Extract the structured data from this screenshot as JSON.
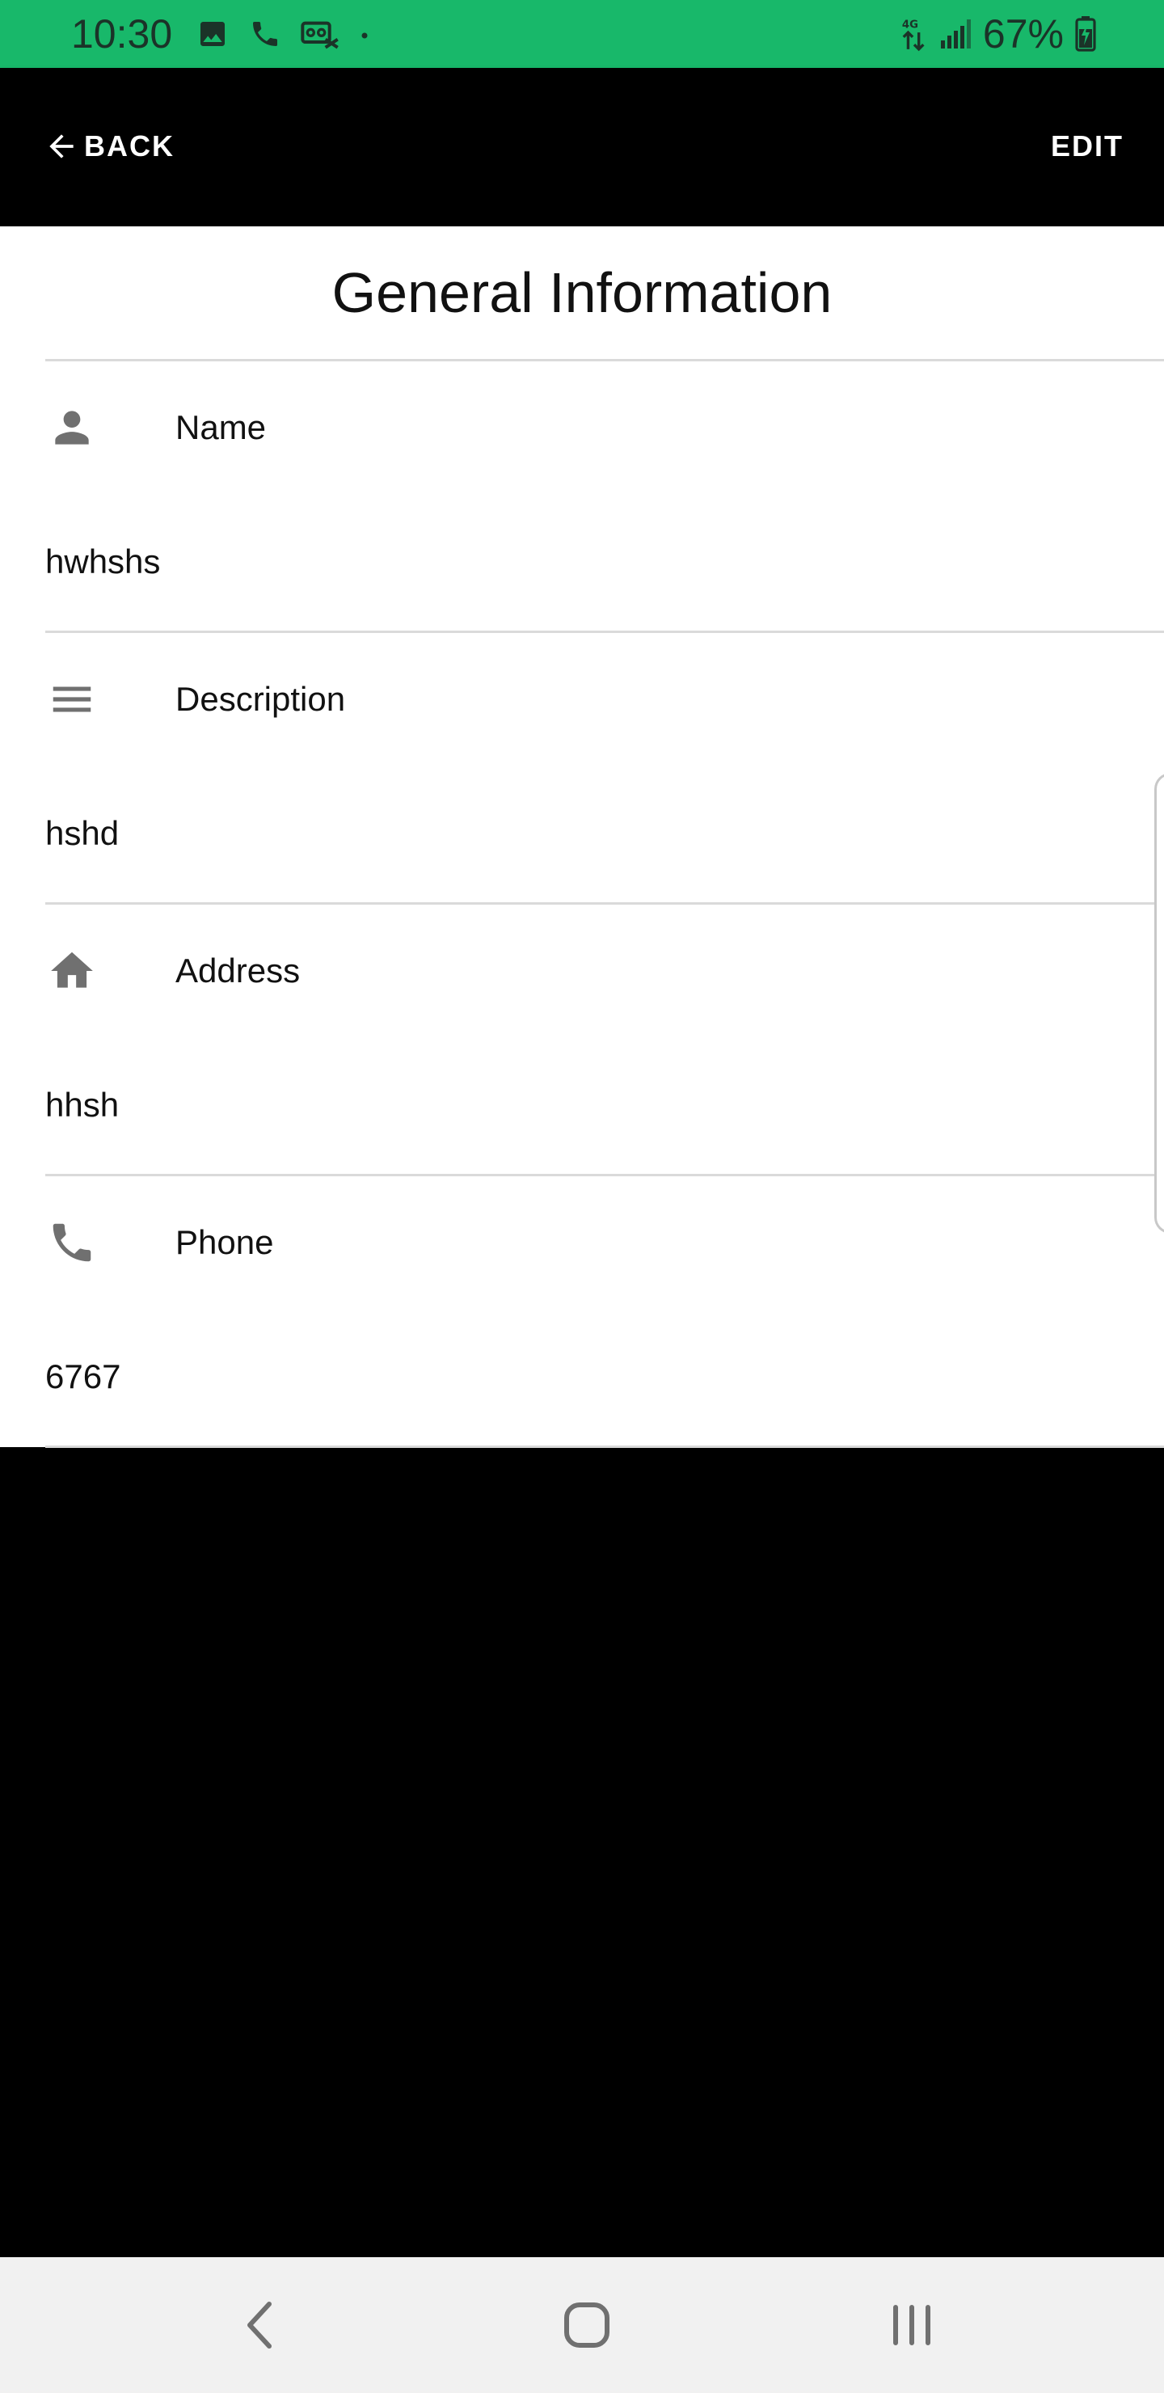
{
  "status_bar": {
    "time": "10:30",
    "battery": "67%",
    "left_icons": [
      "image-icon",
      "phone-icon",
      "voicemail-icon",
      "dot-icon"
    ],
    "right_icons": [
      "data-transfer-icon",
      "signal-icon",
      "battery-charging-icon"
    ]
  },
  "app_bar": {
    "back_label": "BACK",
    "edit_label": "EDIT"
  },
  "page": {
    "title": "General Information"
  },
  "fields": [
    {
      "icon": "person-icon",
      "label": "Name",
      "value": "hwhshs"
    },
    {
      "icon": "menu-lines-icon",
      "label": "Description",
      "value": "hshd"
    },
    {
      "icon": "home-icon",
      "label": "Address",
      "value": "hhsh"
    },
    {
      "icon": "phone-icon",
      "label": "Phone",
      "value": "6767"
    }
  ],
  "nav_bar": {
    "buttons": [
      "back-icon",
      "home-icon",
      "recent-apps-icon"
    ]
  },
  "colors": {
    "status_bar": "#18b86a",
    "app_bar": "#000000",
    "icon_gray": "#707070",
    "divider": "#dadada"
  }
}
